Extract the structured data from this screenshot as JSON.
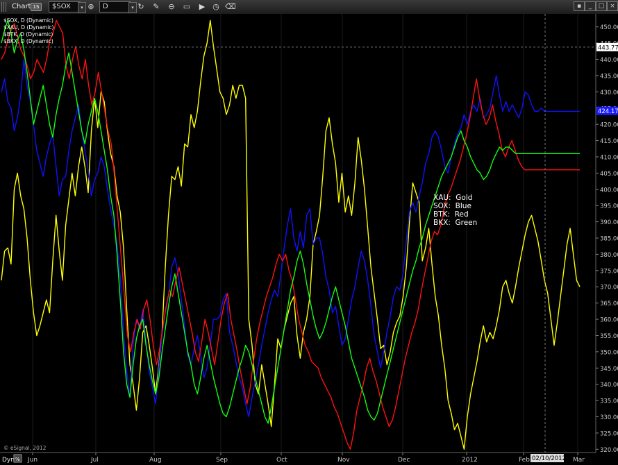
{
  "window": {
    "title": "Chart",
    "title_badge": "1S",
    "symbol_value": "$SOX",
    "interval_value": "D",
    "tools": [
      {
        "name": "refresh-icon",
        "glyph": "↻"
      },
      {
        "name": "pencil-icon",
        "glyph": "✎"
      },
      {
        "name": "link-icon",
        "glyph": "⊖"
      },
      {
        "name": "keyboard-icon",
        "glyph": "▭"
      },
      {
        "name": "play-icon",
        "glyph": "▶"
      },
      {
        "name": "clock-icon",
        "glyph": "◷"
      },
      {
        "name": "eraser-icon",
        "glyph": "⌫"
      }
    ],
    "controls": [
      {
        "name": "menu-button",
        "glyph": "▪"
      },
      {
        "name": "minimize-button",
        "glyph": "_"
      },
      {
        "name": "maximize-button",
        "glyph": "□"
      },
      {
        "name": "close-button",
        "glyph": "×"
      }
    ]
  },
  "series_labels": [
    "$SOX, D (Dynamic)",
    "$XAU, D (Dynamic)",
    "$BTK, D (Dynamic)",
    "$BKX, D (Dynamic)"
  ],
  "legend": [
    {
      "key": "XAU:",
      "value": "Gold"
    },
    {
      "key": "SOX:",
      "value": "Blue"
    },
    {
      "key": "BTK:",
      "value": "Red"
    },
    {
      "key": "BKX:",
      "value": "Green"
    }
  ],
  "copyright": "© eSignal, 2012",
  "bottom": {
    "dyn_label": "Dyn",
    "dyn_badge": "%"
  },
  "crosshair": {
    "price_label": "443.77",
    "date_label": "02/10/2012"
  },
  "last_price_label": "424.17",
  "chart_data": {
    "type": "line",
    "ylim": [
      319,
      454
    ],
    "y_ticks": [
      320,
      325,
      330,
      335,
      340,
      345,
      350,
      355,
      360,
      365,
      370,
      375,
      380,
      385,
      390,
      395,
      400,
      405,
      410,
      415,
      420,
      425,
      430,
      435,
      440,
      445,
      450
    ],
    "x_tick_labels": [
      "Jun",
      "Jul",
      "Aug",
      "Sep",
      "Oct",
      "Nov",
      "Dec",
      "2012",
      "Feb",
      "Mar"
    ],
    "colors": {
      "XAU": "#ffff00",
      "SOX": "#1111ff",
      "BTK": "#ff1111",
      "BKX": "#11ff11"
    },
    "series": [
      {
        "label": "XAU",
        "color": "#ffff00",
        "values": [
          372,
          381,
          382,
          377,
          400,
          405,
          398,
          394,
          385,
          372,
          362,
          355,
          358,
          362,
          366,
          362,
          378,
          392,
          381,
          372,
          389,
          397,
          405,
          398,
          407,
          413,
          407,
          399,
          418,
          428,
          419,
          430,
          427,
          418,
          411,
          407,
          398,
          393,
          382,
          363,
          346,
          340,
          332,
          342,
          356,
          358,
          352,
          345,
          337,
          346,
          356,
          376,
          392,
          404,
          403,
          407,
          401,
          414,
          413,
          423,
          419,
          424,
          433,
          441,
          445,
          452,
          444,
          437,
          430,
          428,
          423,
          426,
          432,
          428,
          432,
          432,
          428,
          360,
          352,
          340,
          337,
          346,
          340,
          334,
          327,
          340,
          354,
          351,
          357,
          361,
          365,
          367,
          355,
          348,
          356,
          360,
          367,
          383,
          387,
          392,
          404,
          418,
          422,
          414,
          408,
          396,
          405,
          393,
          398,
          392,
          402,
          416,
          409,
          400,
          388,
          376,
          368,
          360,
          351,
          352,
          346,
          350,
          356,
          359,
          361,
          367,
          376,
          390,
          402,
          399,
          396,
          378,
          382,
          388,
          377,
          367,
          361,
          352,
          345,
          335,
          331,
          326,
          328,
          324,
          320,
          330,
          337,
          342,
          347,
          353,
          358,
          353,
          356,
          354,
          358,
          363,
          370,
          372,
          368,
          365,
          370,
          376,
          381,
          386,
          390,
          392,
          388,
          384,
          378,
          372,
          368,
          360,
          352,
          359,
          367,
          375,
          383,
          388,
          380,
          372,
          370
        ]
      },
      {
        "label": "SOX",
        "color": "#1111ff",
        "values": [
          430,
          434,
          427,
          425,
          418,
          422,
          429,
          440,
          432,
          427,
          420,
          412,
          408,
          404,
          410,
          414,
          417,
          407,
          398,
          403,
          404,
          412,
          418,
          422,
          426,
          418,
          412,
          406,
          398,
          403,
          405,
          410,
          407,
          400,
          394,
          389,
          383,
          373,
          356,
          344,
          336,
          352,
          360,
          357,
          363,
          353,
          344,
          339,
          334,
          345,
          355,
          362,
          367,
          376,
          379,
          374,
          366,
          358,
          349,
          346,
          351,
          355,
          349,
          342,
          345,
          352,
          360,
          360,
          361,
          366,
          368,
          356,
          352,
          347,
          342,
          339,
          334,
          330,
          336,
          341,
          346,
          352,
          357,
          362,
          366,
          369,
          367,
          374,
          382,
          389,
          394,
          385,
          381,
          387,
          382,
          392,
          394,
          383,
          385,
          385,
          380,
          373,
          369,
          362,
          364,
          358,
          352,
          354,
          360,
          366,
          370,
          376,
          381,
          378,
          372,
          364,
          355,
          350,
          345,
          350,
          356,
          361,
          367,
          370,
          369,
          374,
          384,
          393,
          396,
          393,
          398,
          402,
          408,
          411,
          416,
          418,
          416,
          412,
          407,
          405,
          410,
          414,
          417,
          419,
          423,
          420,
          424,
          426,
          424,
          428,
          422,
          423,
          425,
          430,
          435,
          429,
          424,
          427,
          424,
          426,
          424,
          422,
          425,
          430,
          429,
          426,
          424,
          424,
          425,
          424,
          424,
          424,
          424,
          424,
          424,
          424,
          424,
          424,
          424,
          424,
          424
        ]
      },
      {
        "label": "BTK",
        "color": "#ff1111",
        "values": [
          440,
          442,
          446,
          449,
          451,
          447,
          443,
          441,
          438,
          434,
          436,
          440,
          438,
          436,
          440,
          446,
          448,
          452,
          450,
          448,
          438,
          434,
          440,
          444,
          438,
          434,
          440,
          432,
          426,
          430,
          436,
          430,
          424,
          418,
          414,
          404,
          392,
          380,
          368,
          355,
          350,
          356,
          360,
          357,
          363,
          366,
          360,
          352,
          346,
          351,
          358,
          364,
          369,
          367,
          372,
          376,
          371,
          366,
          361,
          356,
          350,
          347,
          353,
          360,
          356,
          351,
          346,
          353,
          360,
          365,
          368,
          360,
          355,
          350,
          344,
          339,
          334,
          339,
          347,
          354,
          359,
          363,
          367,
          370,
          373,
          377,
          380,
          378,
          380,
          375,
          372,
          366,
          360,
          356,
          352,
          350,
          347,
          346,
          345,
          342,
          340,
          338,
          336,
          333,
          331,
          328,
          325,
          322,
          320,
          325,
          332,
          336,
          340,
          345,
          348,
          344,
          341,
          337,
          333,
          330,
          327,
          329,
          333,
          338,
          343,
          348,
          352,
          356,
          359,
          363,
          369,
          374,
          379,
          384,
          387,
          386,
          389,
          394,
          398,
          400,
          403,
          406,
          409,
          413,
          417,
          422,
          428,
          434,
          428,
          423,
          420,
          422,
          426,
          421,
          417,
          412,
          410,
          413,
          415,
          412,
          409,
          407,
          406,
          406,
          406,
          406,
          406,
          406,
          406,
          406,
          406,
          406,
          406,
          406,
          406,
          406,
          406,
          406,
          406,
          406
        ]
      },
      {
        "label": "BKX",
        "color": "#11ff11",
        "values": [
          445,
          449,
          452,
          448,
          442,
          446,
          448,
          443,
          436,
          428,
          420,
          424,
          428,
          432,
          426,
          420,
          416,
          423,
          428,
          432,
          438,
          442,
          436,
          430,
          424,
          418,
          414,
          420,
          424,
          428,
          424,
          418,
          412,
          406,
          398,
          392,
          380,
          366,
          350,
          340,
          336,
          346,
          354,
          358,
          360,
          352,
          346,
          341,
          337,
          342,
          350,
          357,
          364,
          370,
          374,
          368,
          362,
          356,
          350,
          346,
          340,
          337,
          342,
          348,
          352,
          347,
          342,
          338,
          334,
          331,
          330,
          333,
          337,
          341,
          345,
          348,
          352,
          350,
          346,
          342,
          338,
          334,
          330,
          328,
          333,
          339,
          345,
          351,
          357,
          363,
          369,
          373,
          378,
          381,
          377,
          371,
          366,
          361,
          357,
          354,
          356,
          359,
          363,
          367,
          370,
          366,
          362,
          358,
          353,
          348,
          345,
          342,
          339,
          336,
          332,
          330,
          329,
          331,
          335,
          339,
          343,
          347,
          351,
          355,
          359,
          363,
          367,
          371,
          375,
          378,
          382,
          385,
          389,
          392,
          395,
          398,
          401,
          404,
          406,
          408,
          410,
          413,
          416,
          418,
          415,
          413,
          410,
          408,
          406,
          405,
          403,
          404,
          406,
          409,
          411,
          413,
          412,
          413,
          413,
          412,
          411,
          411,
          411,
          411,
          411,
          411,
          411,
          411,
          411,
          411,
          411,
          411,
          411,
          411,
          411,
          411,
          411,
          411,
          411,
          411,
          411
        ]
      }
    ]
  }
}
